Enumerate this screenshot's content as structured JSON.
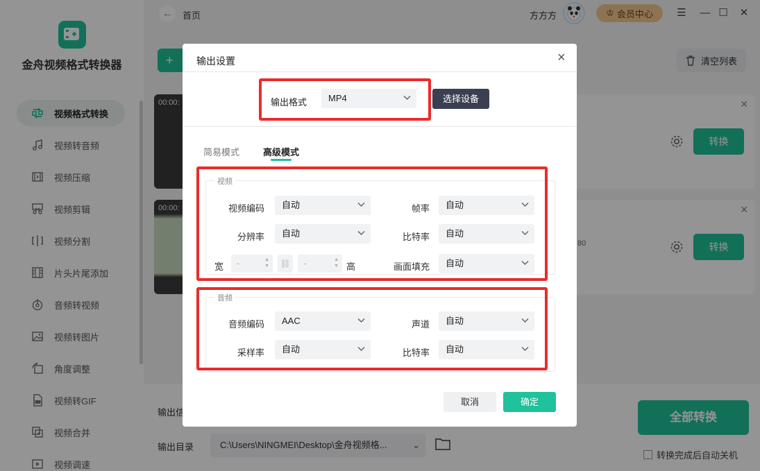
{
  "app": {
    "name": "金舟视频格式转换器"
  },
  "sidebar": {
    "items": [
      {
        "label": "视频格式转换",
        "icon": "convert-icon",
        "active": true
      },
      {
        "label": "视频转音频",
        "icon": "music-icon"
      },
      {
        "label": "视频压缩",
        "icon": "compress-icon"
      },
      {
        "label": "视频剪辑",
        "icon": "scissors-icon"
      },
      {
        "label": "视频分割",
        "icon": "split-icon"
      },
      {
        "label": "片头片尾添加",
        "icon": "film-icon"
      },
      {
        "label": "音频转视频",
        "icon": "audio-disc-icon"
      },
      {
        "label": "视频转图片",
        "icon": "image-icon"
      },
      {
        "label": "角度调整",
        "icon": "rotate-icon"
      },
      {
        "label": "视频转GIF",
        "icon": "gif-icon"
      },
      {
        "label": "视频合并",
        "icon": "merge-icon"
      },
      {
        "label": "视频调速",
        "icon": "speed-icon"
      }
    ]
  },
  "topbar": {
    "crumb": "首页",
    "username": "方方方",
    "vip": "会员中心",
    "controls": [
      "☰",
      "—",
      "☐",
      "✕"
    ]
  },
  "main": {
    "clear_list": "清空列表",
    "files": [
      {
        "time": "00:00:",
        "convert": "转换"
      },
      {
        "time": "00:00:",
        "convert": "转换",
        "fragment": "80"
      }
    ]
  },
  "bottom": {
    "output_info_label": "输出信",
    "output_dir_label": "输出目录",
    "output_dir": "C:\\Users\\NINGMEI\\Desktop\\金舟视频格...",
    "all_convert": "全部转换",
    "auto_shutdown": "转换完成后自动关机"
  },
  "dialog": {
    "title": "输出设置",
    "format_label": "输出格式",
    "format_value": "MP4",
    "select_device": "选择设备",
    "tabs": [
      {
        "label": "简易模式",
        "active": false
      },
      {
        "label": "高级模式",
        "active": true
      }
    ],
    "video": {
      "title": "视频",
      "codec_label": "视频编码",
      "codec": "自动",
      "framerate_label": "帧率",
      "framerate": "自动",
      "resolution_label": "分辨率",
      "resolution": "自动",
      "bitrate_label": "比特率",
      "bitrate": "自动",
      "width_label": "宽",
      "width": "-",
      "height_label": "高",
      "height": "-",
      "fill_label": "画面填充",
      "fill": "自动"
    },
    "audio": {
      "title": "音频",
      "codec_label": "音频编码",
      "codec": "AAC",
      "channel_label": "声道",
      "channel": "自动",
      "samplerate_label": "采样率",
      "samplerate": "自动",
      "bitrate_label": "比特率",
      "bitrate": "自动"
    },
    "cancel": "取消",
    "confirm": "确定"
  },
  "colors": {
    "accent": "#1fc29a",
    "highlight": "#ea2b2b",
    "dark_button": "#3a3f51"
  }
}
